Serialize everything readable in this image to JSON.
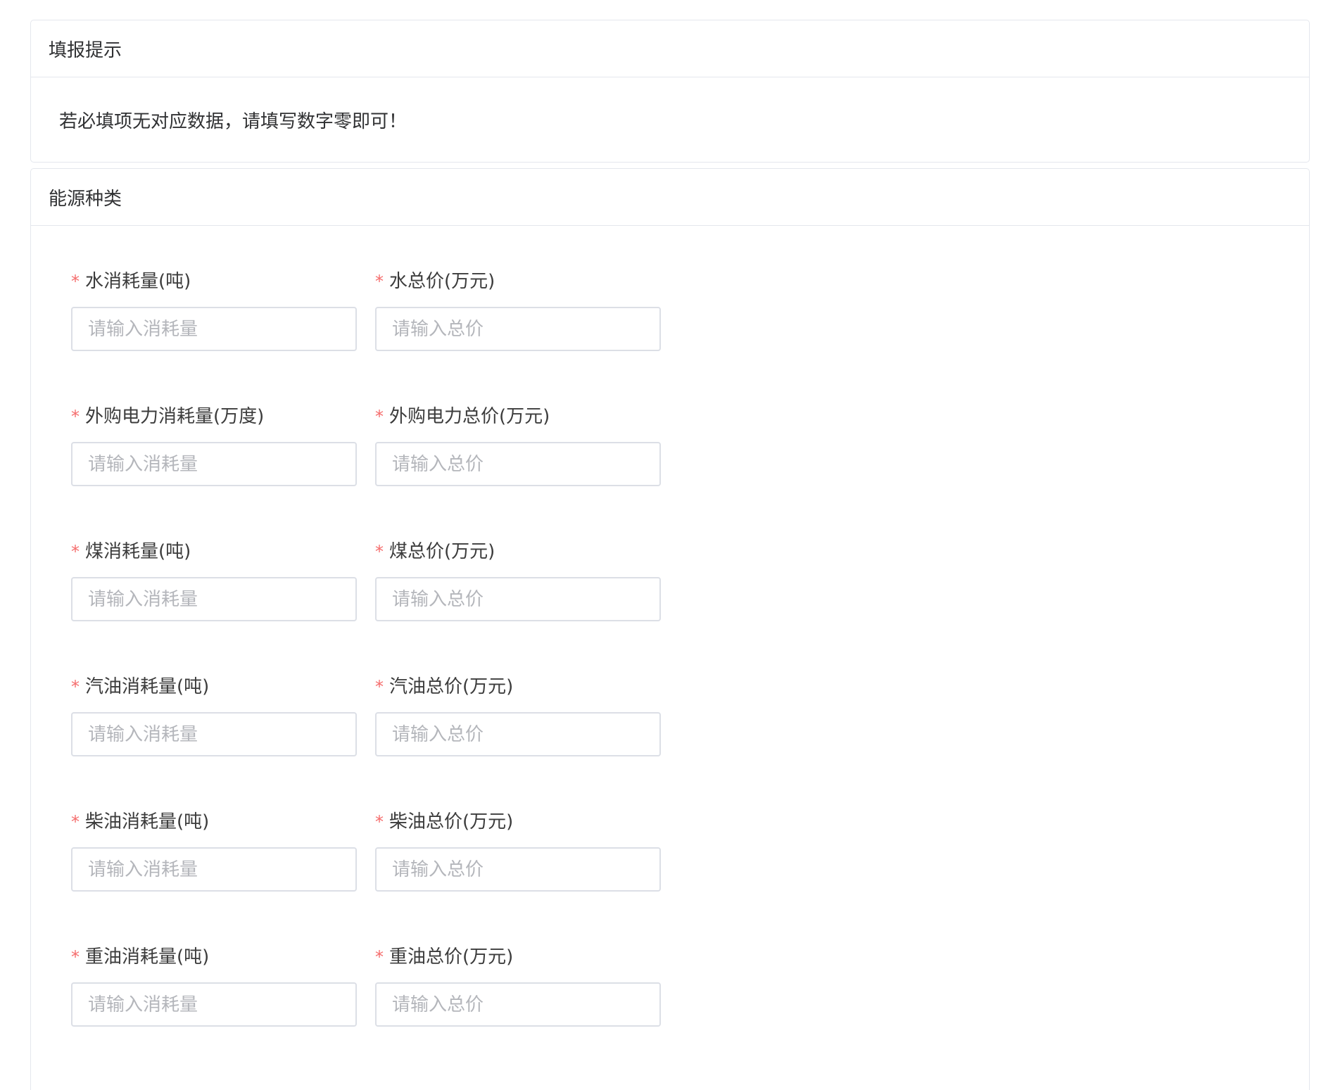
{
  "tip_card": {
    "title": "填报提示",
    "message": "若必填项无对应数据，请填写数字零即可！"
  },
  "energy_card": {
    "title": "能源种类",
    "required_mark": "*",
    "rows": [
      {
        "consumption": {
          "label": "水消耗量(吨)",
          "placeholder": "请输入消耗量",
          "value": ""
        },
        "price": {
          "label": "水总价(万元)",
          "placeholder": "请输入总价",
          "value": ""
        }
      },
      {
        "consumption": {
          "label": "外购电力消耗量(万度)",
          "placeholder": "请输入消耗量",
          "value": ""
        },
        "price": {
          "label": "外购电力总价(万元)",
          "placeholder": "请输入总价",
          "value": ""
        }
      },
      {
        "consumption": {
          "label": "煤消耗量(吨)",
          "placeholder": "请输入消耗量",
          "value": ""
        },
        "price": {
          "label": "煤总价(万元)",
          "placeholder": "请输入总价",
          "value": ""
        }
      },
      {
        "consumption": {
          "label": "汽油消耗量(吨)",
          "placeholder": "请输入消耗量",
          "value": ""
        },
        "price": {
          "label": "汽油总价(万元)",
          "placeholder": "请输入总价",
          "value": ""
        }
      },
      {
        "consumption": {
          "label": "柴油消耗量(吨)",
          "placeholder": "请输入消耗量",
          "value": ""
        },
        "price": {
          "label": "柴油总价(万元)",
          "placeholder": "请输入总价",
          "value": ""
        }
      },
      {
        "consumption": {
          "label": "重油消耗量(吨)",
          "placeholder": "请输入消耗量",
          "value": ""
        },
        "price": {
          "label": "重油总价(万元)",
          "placeholder": "请输入总价",
          "value": ""
        }
      }
    ]
  },
  "colors": {
    "required": "#f56c6c",
    "border": "#dcdfe6",
    "card_border": "#e4e7ed",
    "placeholder": "#b4b6bb",
    "text": "#303133"
  }
}
